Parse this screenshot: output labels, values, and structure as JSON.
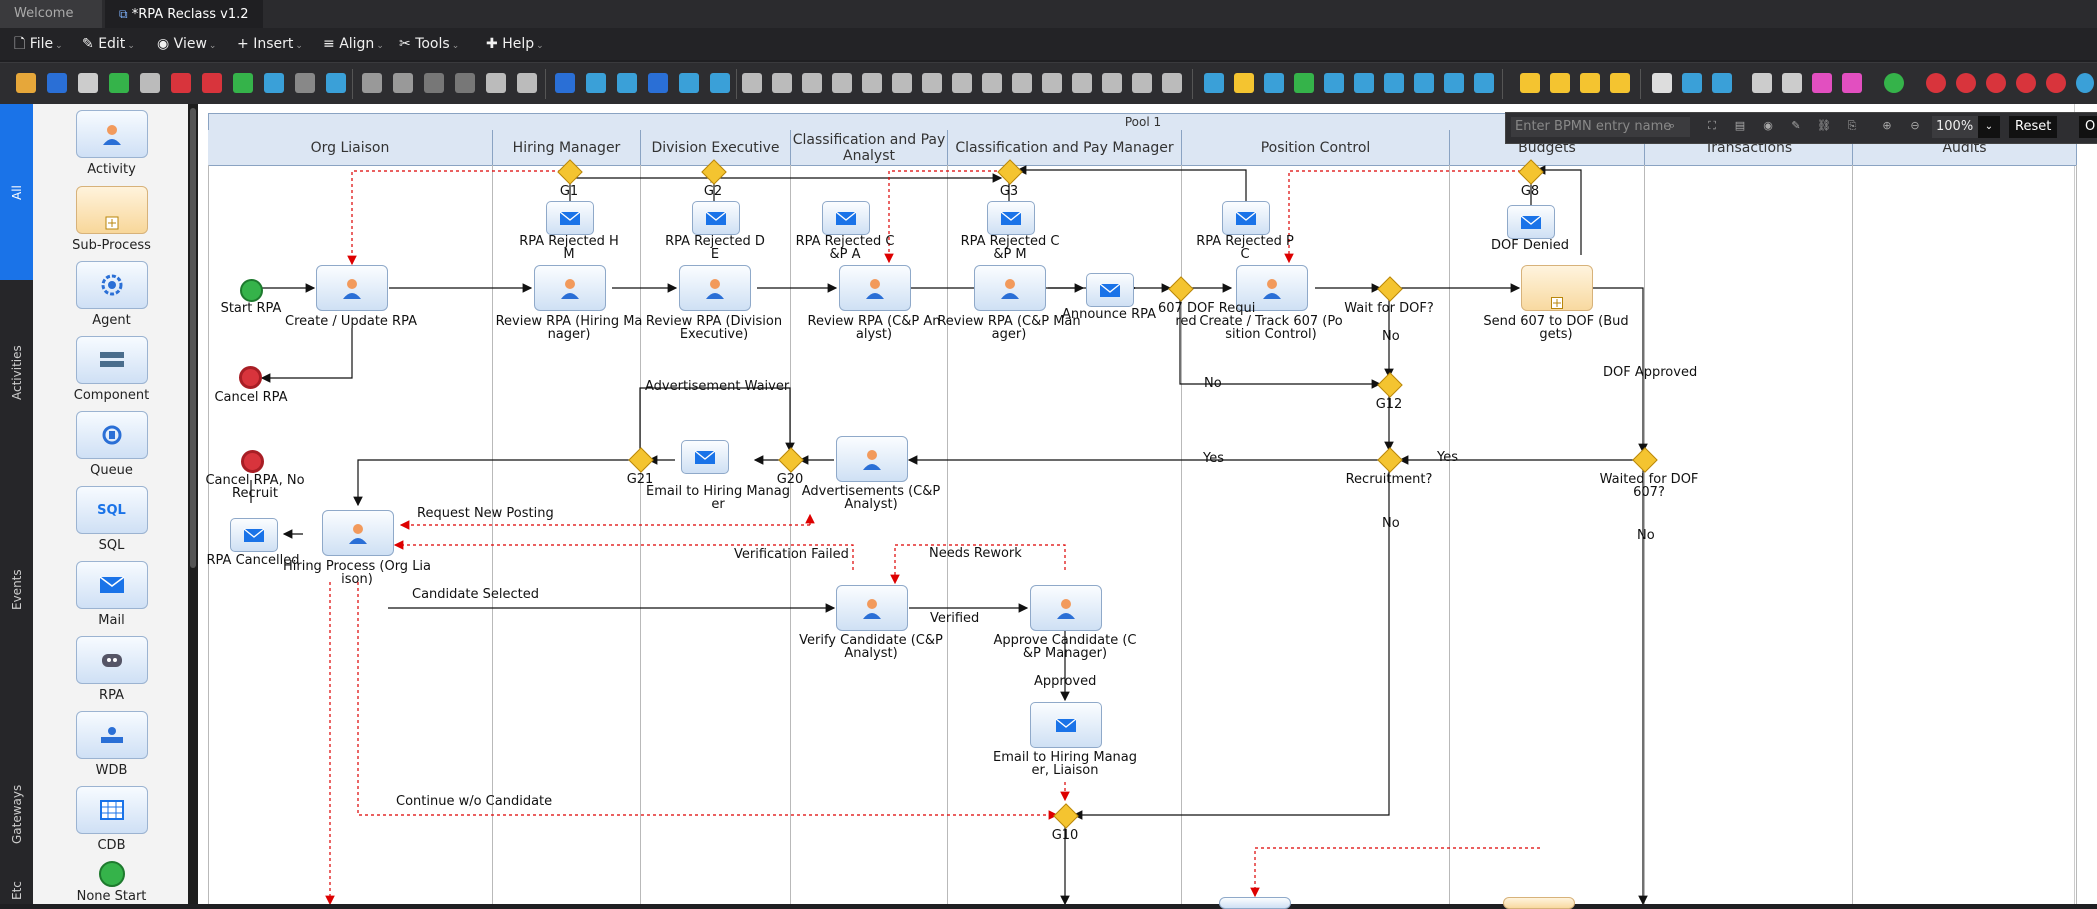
{
  "tabs": [
    {
      "label": "Welcome",
      "active": false
    },
    {
      "label": "*RPA Reclass v1.2",
      "active": true
    }
  ],
  "menu": [
    {
      "label": "File",
      "icon": "file-icon"
    },
    {
      "label": "Edit",
      "icon": "edit-icon"
    },
    {
      "label": "View",
      "icon": "eye-icon"
    },
    {
      "label": "Insert",
      "icon": "plus-icon"
    },
    {
      "label": "Align",
      "icon": "align-icon"
    },
    {
      "label": "Tools",
      "icon": "tools-icon"
    },
    {
      "label": "Help",
      "icon": "help-icon"
    }
  ],
  "sidebar_tabs": [
    "All",
    "Activities",
    "Events",
    "Gateways",
    "Etc"
  ],
  "palette": [
    {
      "label": "Activity",
      "icon": "user-task-icon"
    },
    {
      "label": "Sub-Process",
      "icon": "subprocess-icon"
    },
    {
      "label": "Agent",
      "icon": "agent-gear-icon"
    },
    {
      "label": "Component",
      "icon": "component-icon"
    },
    {
      "label": "Queue",
      "icon": "queue-icon"
    },
    {
      "label": "SQL",
      "icon": "sql-icon"
    },
    {
      "label": "Mail",
      "icon": "mail-icon"
    },
    {
      "label": "RPA",
      "icon": "robot-icon"
    },
    {
      "label": "WDB",
      "icon": "wdb-icon"
    },
    {
      "label": "CDB",
      "icon": "table-icon"
    },
    {
      "label": "None Start",
      "icon": "start-event-icon"
    }
  ],
  "search": {
    "placeholder": "Enter BPMN entry name",
    "zoom": "100%",
    "reset": "Reset",
    "extra": "O"
  },
  "pool": {
    "title": "Pool 1"
  },
  "lanes": [
    "Org Liaison",
    "Hiring Manager",
    "Division Executive",
    "Classification and Pay Analyst",
    "Classification and Pay Manager",
    "Position Control",
    "Budgets",
    "Transactions",
    "Audits"
  ],
  "tasks": {
    "create": "Create / Update RPA",
    "review_hm": "Review RPA (Hiring Ma\nnager)",
    "review_de": "Review RPA (Division\nExecutive)",
    "review_cpa": "Review RPA (C&P An\nalyst)",
    "review_cpm": "Review RPA (C&P Man\nager)",
    "track607": "Create / Track 607 (Po\nsition Control)",
    "send607": "Send 607 to DOF (Bud\ngets)",
    "advert": "Advertisements (C&P\nAnalyst)",
    "hiring": "Hiring Process (Org Lia\nison)",
    "verify": "Verify Candidate (C&P\nAnalyst)",
    "approve": "Approve Candidate (C\n&P Manager)"
  },
  "mails": {
    "rej_hm": "RPA Rejected H\nM",
    "rej_de": "RPA Rejected D\nE",
    "rej_cpa": "RPA Rejected C\n&P A",
    "rej_cpm": "RPA Rejected C\n&P M",
    "rej_pc": "RPA Rejected P\nC",
    "dof_denied": "DOF Denied",
    "announce": "Announce RPA",
    "email_hm": "Email to Hiring Manag\ner",
    "cancelled": "RPA Cancelled",
    "email_hm_liaison": "Email to Hiring Manag\ner, Liaison"
  },
  "events": {
    "start": "Start RPA",
    "cancel": "Cancel RPA",
    "cancel_norecruit": "Cancel RPA, No\nRecruit"
  },
  "gateways": {
    "g1": "G1",
    "g2": "G2",
    "g3": "G3",
    "g8": "G8",
    "dof_required": "607 DOF Requi\nred",
    "wait_dof": "Wait for DOF?",
    "g12": "G12",
    "recruitment": "Recruitment?",
    "waited_dof": "Waited for DOF\n607?",
    "g20": "G20",
    "g21": "G21",
    "g10": "G10"
  },
  "flow_labels": {
    "no1": "No",
    "no2": "No",
    "no3": "No",
    "no4": "No",
    "yes1": "Yes",
    "yes2": "Yes",
    "dof_approved": "DOF Approved",
    "ad_waiver": "Advertisement Waiver",
    "req_new": "Request New Posting",
    "cand_sel": "Candidate Selected",
    "ver_failed": "Verification Failed",
    "needs_rework": "Needs Rework",
    "verified": "Verified",
    "approved": "Approved",
    "continue_wo": "Continue w/o Candidate"
  }
}
